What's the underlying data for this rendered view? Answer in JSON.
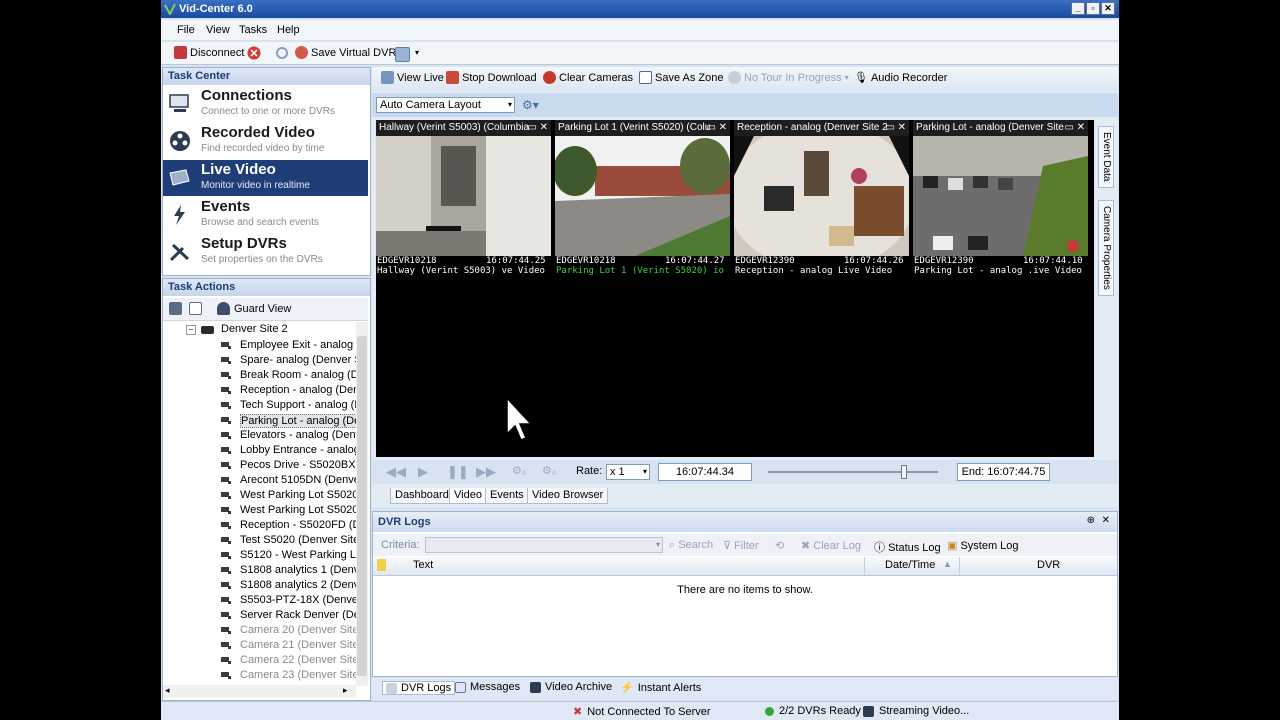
{
  "window": {
    "title": "Vid-Center 6.0",
    "minimize": "_",
    "maximize": "▫",
    "close": "✕"
  },
  "menu": [
    "File",
    "View",
    "Tasks",
    "Help"
  ],
  "toolbar": {
    "disconnect": "Disconnect",
    "save_virtual_dvr": "Save Virtual DVR"
  },
  "task_center": {
    "title": "Task Center",
    "items": [
      {
        "title": "Connections",
        "subtitle": "Connect to one or more DVRs"
      },
      {
        "title": "Recorded Video",
        "subtitle": "Find recorded video by time"
      },
      {
        "title": "Live Video",
        "subtitle": "Monitor video in realtime"
      },
      {
        "title": "Events",
        "subtitle": "Browse and search events"
      },
      {
        "title": "Setup DVRs",
        "subtitle": "Set properties on the DVRs"
      }
    ]
  },
  "task_actions": {
    "title": "Task Actions",
    "guard_view": "Guard View",
    "tree_root": "Denver Site 2",
    "cameras": [
      "Employee Exit - analog (D",
      "Spare- analog (Denver Si",
      "Break Room - analog (Der",
      "Reception - analog (Denv",
      "Tech Support - analog (D",
      "Parking Lot - analog (Den",
      "Elevators - analog (Denve",
      "Lobby Entrance - analog",
      "Pecos Drive - S5020BX IP",
      "Arecont 5105DN (Denver",
      "West Parking Lot S5020B",
      "West Parking Lot S5020B",
      "Reception - S5020FD (De",
      "Test S5020 (Denver Site",
      "S5120 - West Parking Lot",
      "S1808 analytics 1 (Denve",
      "S1808 analytics 2 (Denve",
      "S5503-PTZ-18X (Denver S",
      "Server Rack Denver (Den",
      "Camera 20 (Denver Site 2",
      "Camera 21 (Denver Site 2",
      "Camera 22 (Denver Site 2",
      "Camera 23 (Denver Site 2"
    ]
  },
  "main_toolbar": {
    "view_live": "View Live",
    "stop_download": "Stop Download",
    "clear_cameras": "Clear Cameras",
    "save_as_zone": "Save As Zone",
    "tour": "No Tour In Progress",
    "audio_recorder": "Audio Recorder"
  },
  "layout_select": "Auto Camera Layout",
  "side_tabs": [
    "Event Data",
    "Camera Properties"
  ],
  "tiles": [
    {
      "header": "Hallway (Verint S5003) (Columbia",
      "dvr": "EDGEVR10218",
      "time": "16:07:44.25",
      "caption": "Hallway (Verint S5003) ve Video"
    },
    {
      "header": "Parking Lot 1 (Verint S5020) (Colu",
      "dvr": "EDGEVR10218",
      "time": "16:07:44.27",
      "caption": "Parking Lot 1 (Verint S5020) io"
    },
    {
      "header": "Reception - analog (Denver Site 2",
      "dvr": "EDGEVR12390",
      "time": "16:07:44.26",
      "caption": "Reception - analog   Live Video"
    },
    {
      "header": "Parking Lot - analog (Denver Site",
      "dvr": "EDGEVR12390",
      "time": "16:07:44.10",
      "caption": "Parking Lot - analog .ive Video"
    }
  ],
  "playback": {
    "rate_label": "Rate:",
    "rate_value": "x 1",
    "current_time": "16:07:44.34",
    "end_time": "End: 16:07:44.75",
    "slider_position": 0.8
  },
  "view_tabs": [
    "Dashboard",
    "Video",
    "Events",
    "Video Browser"
  ],
  "dvr_logs": {
    "title": "DVR Logs",
    "criteria_label": "Criteria:",
    "search": "Search",
    "filter": "Filter",
    "clear_log": "Clear Log",
    "status_log": "Status Log",
    "system_log": "System Log",
    "columns": [
      "Text",
      "Date/Time",
      "DVR"
    ],
    "empty_message": "There are no items to show."
  },
  "log_tabs": [
    "DVR Logs",
    "Messages",
    "Video Archive",
    "Instant Alerts"
  ],
  "status": {
    "server": "Not Connected To Server",
    "dvrs": "2/2 DVRs Ready",
    "streaming": "Streaming Video..."
  },
  "colors": {
    "selected_task": "#1f3e78",
    "title_bar": "#2a5cb0",
    "green_caption": "#3cd23c"
  }
}
